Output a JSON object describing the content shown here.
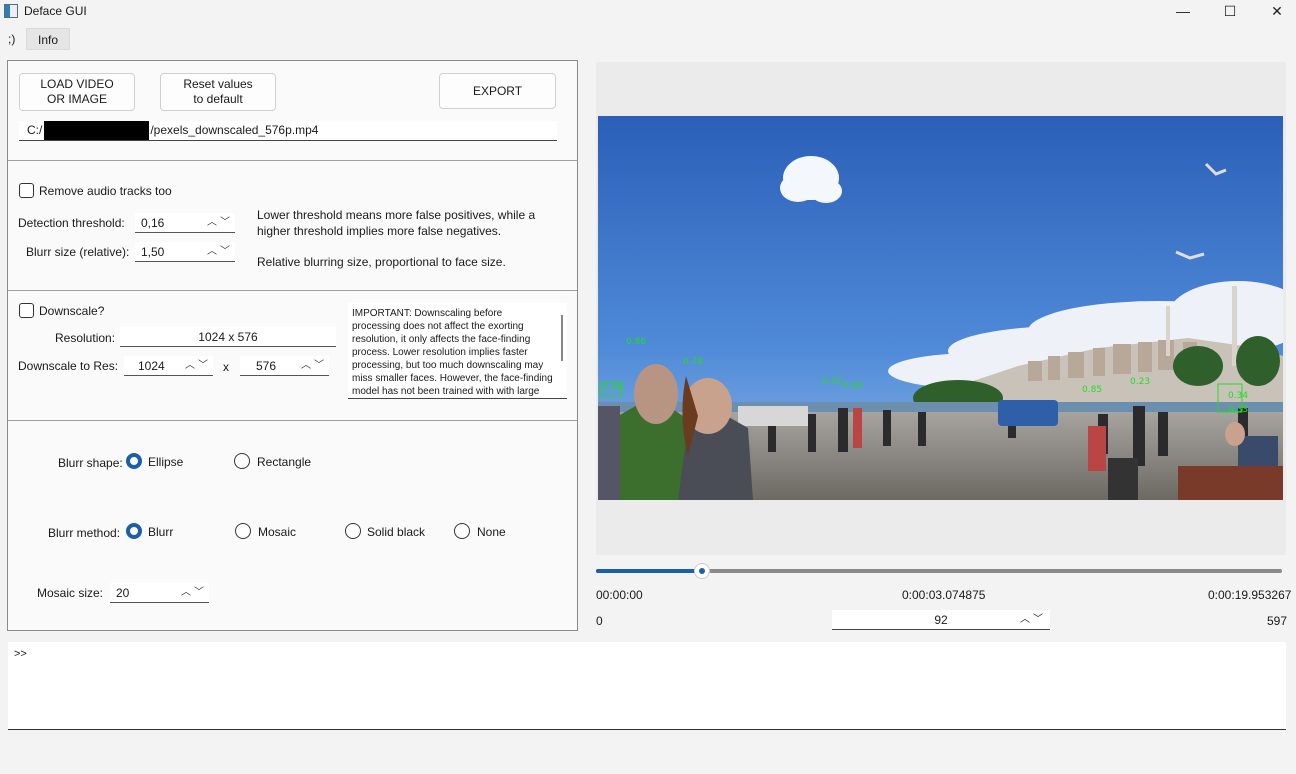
{
  "window": {
    "title": "Deface GUI",
    "minimize": "—",
    "maximize": "☐",
    "close": "✕"
  },
  "menu": [
    {
      "label": ";)"
    },
    {
      "label": "Info"
    }
  ],
  "top": {
    "load_button": "LOAD VIDEO\nOR IMAGE",
    "reset_button": "Reset values\nto default",
    "export_button": "EXPORT",
    "file_path_prefix": "C:/",
    "file_path_suffix": "/pexels_downscaled_576p.mp4"
  },
  "detection": {
    "remove_audio_label": "Remove audio tracks too",
    "threshold_label": "Detection threshold:",
    "threshold_value": "0,16",
    "threshold_help": "Lower threshold means more false positives, while a higher threshold implies more false negatives.",
    "blur_size_label": "Blurr size (relative):",
    "blur_size_value": "1,50",
    "blur_size_help": "Relative blurring size, proportional to face size."
  },
  "downscale": {
    "checkbox_label": "Downscale?",
    "resolution_label": "Resolution:",
    "resolution_value": "1024 x 576",
    "downscale_to_label": "Downscale to Res:",
    "width_value": "1024",
    "x_label": "x",
    "height_value": "576",
    "note": "IMPORTANT: Downscaling before processing does not affect the exorting resolution, it only affects the face-finding process. Lower resolution implies faster processing, but too much downscaling may miss smaller faces. However, the face-finding model has not been trained with with large images and"
  },
  "blur": {
    "shape_label": "Blurr shape:",
    "shape_options": [
      "Ellipse",
      "Rectangle"
    ],
    "method_label": "Blurr method:",
    "method_options": [
      "Blurr",
      "Mosaic",
      "Solid black",
      "None"
    ],
    "mosaic_label": "Mosaic size:",
    "mosaic_value": "20"
  },
  "player": {
    "time_start": "00:00:00",
    "time_current": "0:00:03.074875",
    "time_end": "0:00:19.953267",
    "frame_start": "0",
    "frame_current": "92",
    "frame_end": "597",
    "progress": 0.155
  },
  "overlay_labels": [
    "0.86",
    "0.78",
    "0.37",
    "0.28",
    "0.26",
    "0.85",
    "0.23",
    "0.34",
    "0.33"
  ],
  "console": {
    "prompt": ">>"
  },
  "colors": {
    "accent": "#1b5fa8",
    "detection_box": "#22dd22"
  }
}
